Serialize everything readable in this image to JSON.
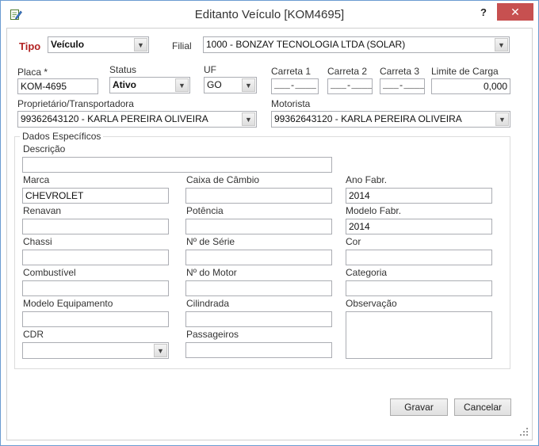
{
  "window": {
    "title": "Editanto Veículo [KOM4695]",
    "help_label": "?",
    "close_label": "✕"
  },
  "header": {
    "tipo_label": "Tipo",
    "tipo_value": "Veículo",
    "filial_label": "Filial",
    "filial_value": "1000 - BONZAY TECNOLOGIA LTDA (SOLAR)"
  },
  "row1": {
    "placa_label": "Placa *",
    "placa_value": "KOM-4695",
    "status_label": "Status",
    "status_value": "Ativo",
    "uf_label": "UF",
    "uf_value": "GO",
    "carreta1_label": "Carreta 1",
    "carreta1_value": "___-____",
    "carreta2_label": "Carreta 2",
    "carreta2_value": "___-____",
    "carreta3_label": "Carreta 3",
    "carreta3_value": "___-____",
    "limite_label": "Limite de Carga",
    "limite_value": "0,000"
  },
  "row2": {
    "proprietario_label": "Proprietário/Transportadora",
    "proprietario_value": "99362643120 - KARLA PEREIRA OLIVEIRA",
    "motorista_label": "Motorista",
    "motorista_value": "99362643120 - KARLA PEREIRA OLIVEIRA"
  },
  "dados": {
    "legend": "Dados Específicos",
    "descricao_label": "Descrição",
    "descricao_value": "",
    "marca_label": "Marca",
    "marca_value": "CHEVROLET",
    "cambio_label": "Caixa de Câmbio",
    "cambio_value": "",
    "ano_fabr_label": "Ano Fabr.",
    "ano_fabr_value": "2014",
    "renavan_label": "Renavan",
    "renavan_value": "",
    "potencia_label": "Potência",
    "potencia_value": "",
    "modelo_fabr_label": "Modelo Fabr.",
    "modelo_fabr_value": "2014",
    "chassi_label": "Chassi",
    "chassi_value": "",
    "serie_label": "Nº de Série",
    "serie_value": "",
    "cor_label": "Cor",
    "cor_value": "",
    "combustivel_label": "Combustível",
    "combustivel_value": "",
    "motor_label": "Nº do Motor",
    "motor_value": "",
    "categoria_label": "Categoria",
    "categoria_value": "",
    "modelo_equip_label": "Modelo Equipamento",
    "modelo_equip_value": "",
    "cilindrada_label": "Cilindrada",
    "cilindrada_value": "",
    "observacao_label": "Observação",
    "cdr_label": "CDR",
    "cdr_value": "",
    "passageiros_label": "Passageiros",
    "passageiros_value": ""
  },
  "footer": {
    "gravar_label": "Gravar",
    "cancelar_label": "Cancelar"
  },
  "colors": {
    "close_button": "#c75050",
    "tipo_label": "#b22222",
    "window_border": "#6b9bd1"
  }
}
